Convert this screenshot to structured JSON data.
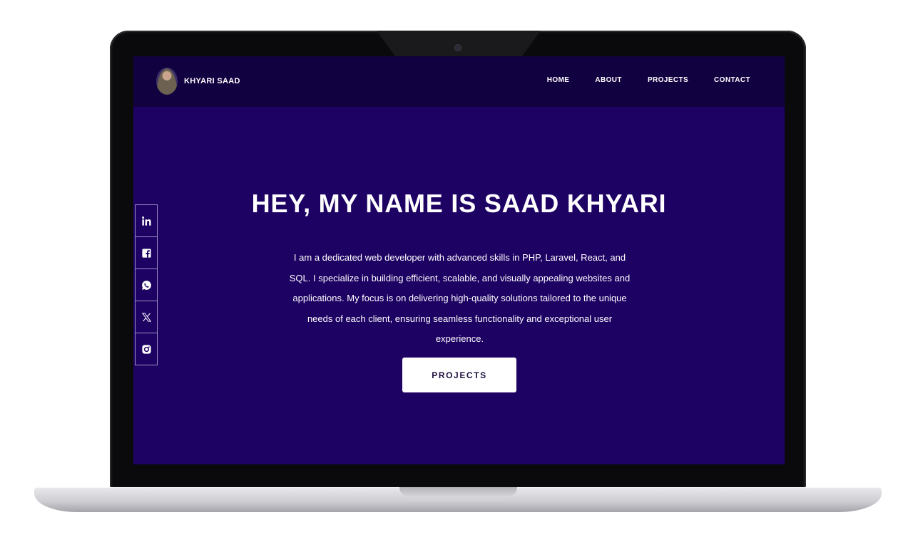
{
  "brand": {
    "name": "KHYARI SAAD"
  },
  "nav": {
    "items": [
      {
        "label": "HOME"
      },
      {
        "label": "ABOUT"
      },
      {
        "label": "PROJECTS"
      },
      {
        "label": "CONTACT"
      }
    ]
  },
  "social": {
    "items": [
      {
        "icon": "linkedin-icon"
      },
      {
        "icon": "facebook-icon"
      },
      {
        "icon": "whatsapp-icon"
      },
      {
        "icon": "x-twitter-icon"
      },
      {
        "icon": "instagram-icon"
      }
    ]
  },
  "hero": {
    "title": "HEY, MY NAME IS SAAD KHYARI",
    "description": "I am a dedicated web developer with advanced skills in PHP, Laravel, React, and SQL. I specialize in building efficient, scalable, and visually appealing websites and applications. My focus is on delivering high-quality solutions tailored to the unique needs of each client, ensuring seamless functionality and exceptional user experience.",
    "button_label": "PROJECTS"
  },
  "colors": {
    "screen_background": "#1d0163",
    "navbar_background": "#120140",
    "text": "#ffffff",
    "button_text": "#1d0f3d"
  }
}
